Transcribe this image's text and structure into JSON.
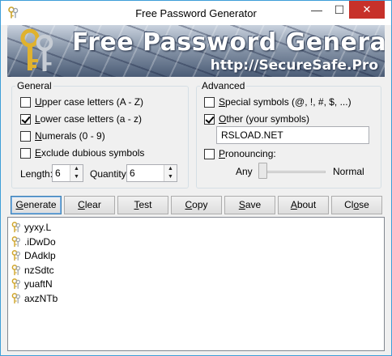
{
  "window": {
    "title": "Free Password Generator",
    "minimize_glyph": "—",
    "maximize_glyph": "☐",
    "close_glyph": "✕"
  },
  "banner": {
    "title": "Free Password Generator",
    "url": "http://SecureSafe.Pro"
  },
  "general": {
    "legend": "General",
    "upper": {
      "pre": "",
      "ul": "U",
      "post": "pper case letters (A - Z)",
      "checked": false
    },
    "lower": {
      "pre": "",
      "ul": "L",
      "post": "ower case letters (a - z)",
      "checked": true
    },
    "numerals": {
      "pre": "",
      "ul": "N",
      "post": "umerals (0 - 9)",
      "checked": false
    },
    "exclude": {
      "pre": "",
      "ul": "E",
      "post": "xclude dubious symbols",
      "checked": false
    },
    "length_label": "Length:",
    "length_value": "6",
    "quantity_label": "Quantity:",
    "quantity_value": "6"
  },
  "advanced": {
    "legend": "Advanced",
    "special": {
      "pre": "",
      "ul": "S",
      "post": "pecial symbols (@, !, #, $, ...)",
      "checked": false
    },
    "other": {
      "pre": "",
      "ul": "O",
      "post": "ther (your symbols)",
      "checked": true
    },
    "other_value": "RSLOAD.NET",
    "pronouncing": {
      "pre": "",
      "ul": "P",
      "post": "ronouncing:",
      "checked": false
    },
    "slider_min_label": "Any",
    "slider_max_label": "Normal",
    "slider_level": 0
  },
  "buttons": [
    {
      "pre": "",
      "ul": "G",
      "post": "enerate"
    },
    {
      "pre": "",
      "ul": "C",
      "post": "lear"
    },
    {
      "pre": "",
      "ul": "T",
      "post": "est"
    },
    {
      "pre": "",
      "ul": "C",
      "post": "opy"
    },
    {
      "pre": "",
      "ul": "S",
      "post": "ave"
    },
    {
      "pre": "",
      "ul": "A",
      "post": "bout"
    },
    {
      "pre": "Cl",
      "ul": "o",
      "post": "se"
    }
  ],
  "passwords": [
    "yyxy.L",
    ".iDwDo",
    "DAdklp",
    "nzSdtc",
    "yuaftN",
    "axzNTb"
  ],
  "icons": {
    "app": "keys-icon",
    "banner": "keys-icon",
    "result": "key-icon"
  },
  "colors": {
    "accent": "#3e9ed8",
    "close": "#c7312a"
  }
}
